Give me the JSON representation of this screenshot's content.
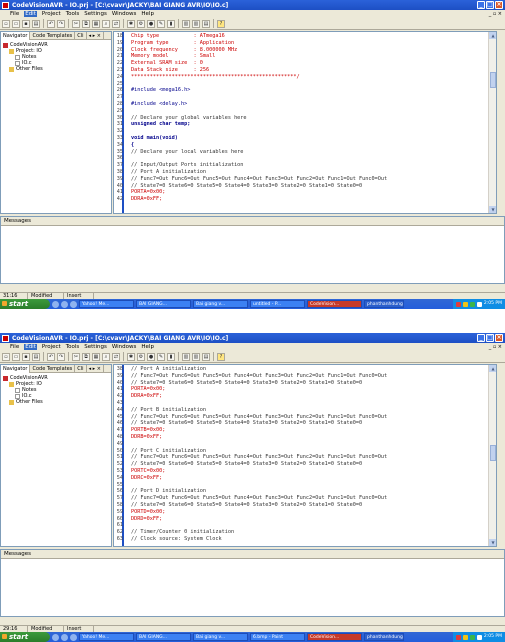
{
  "colors": {
    "titlebar": "#2b62d9",
    "gutter": "#1d4fc4",
    "code_text": "#cc0000",
    "keyword": "#00008b",
    "taskbar": "#245edb"
  },
  "screens": [
    {
      "title": "CodeVisionAVR - IO.prj - [C:\\cvavr\\JACKY\\BAI GIANG AVR\\IO\\IO.c]",
      "menu": [
        "File",
        "Edit",
        "Project",
        "Tools",
        "Settings",
        "Windows",
        "Help"
      ],
      "nav_tabs": [
        "Navigator",
        "Code Templates",
        "Cli"
      ],
      "tree": [
        "CodeVisionAVR",
        "Project: IO",
        "Notes",
        "IO.c",
        "Other Files"
      ],
      "code": [
        {
          "n": "18",
          "t": "Chip type           : ATmega16",
          "k": "str"
        },
        {
          "n": "19",
          "t": "Program type        : Application",
          "k": "str"
        },
        {
          "n": "20",
          "t": "Clock frequency     : 8.000000 MHz",
          "k": "str"
        },
        {
          "n": "21",
          "t": "Memory model        : Small",
          "k": "str"
        },
        {
          "n": "22",
          "t": "External SRAM size  : 0",
          "k": "str"
        },
        {
          "n": "23",
          "t": "Data Stack size     : 256",
          "k": "str"
        },
        {
          "n": "24",
          "t": "*****************************************************/",
          "k": "str"
        },
        {
          "n": "25",
          "t": "",
          "k": "str"
        },
        {
          "n": "26",
          "t": "#include <mega16.h>",
          "k": "inc"
        },
        {
          "n": "27",
          "t": "",
          "k": "str"
        },
        {
          "n": "28",
          "t": "#include <delay.h>",
          "k": "inc"
        },
        {
          "n": "29",
          "t": "",
          "k": "str"
        },
        {
          "n": "30",
          "t": "// Declare your global variables here",
          "k": "cm"
        },
        {
          "n": "31",
          "t": "unsigned char temp;",
          "k": "kw"
        },
        {
          "n": "32",
          "t": "",
          "k": "str"
        },
        {
          "n": "33",
          "t": "void main(void)",
          "k": "kw"
        },
        {
          "n": "34",
          "t": "{",
          "k": "kw"
        },
        {
          "n": "35",
          "t": "// Declare your local variables here",
          "k": "cm"
        },
        {
          "n": "36",
          "t": "",
          "k": "str"
        },
        {
          "n": "37",
          "t": "// Input/Output Ports initialization",
          "k": "cm"
        },
        {
          "n": "38",
          "t": "// Port A initialization",
          "k": "cm"
        },
        {
          "n": "39",
          "t": "// Func7=Out Func6=Out Func5=Out Func4=Out Func3=Out Func2=Out Func1=Out Func0=Out",
          "k": "cm"
        },
        {
          "n": "40",
          "t": "// State7=0 State6=0 State5=0 State4=0 State3=0 State2=0 State1=0 State0=0",
          "k": "cm"
        },
        {
          "n": "41",
          "t": "PORTA=0x00;",
          "k": "str"
        },
        {
          "n": "42",
          "t": "DDRA=0xFF;",
          "k": "str"
        }
      ],
      "messages_title": "Messages",
      "status": {
        "pos": "31:16",
        "modified": "Modified",
        "mode": "Insert"
      },
      "taskbar": {
        "start": "start",
        "items": [
          "Yahoo! Me...",
          "BAI GIANG...",
          "Bai giang v...",
          "untitled - P...",
          "CodeVision...",
          "phanthanhdung"
        ],
        "clock": "2:05 PM"
      }
    },
    {
      "title": "CodeVisionAVR - IO.prj - [C:\\cvavr\\JACKY\\BAI GIANG AVR\\IO\\IO.c]",
      "menu": [
        "File",
        "Edit",
        "Project",
        "Tools",
        "Settings",
        "Windows",
        "Help"
      ],
      "nav_tabs": [
        "Navigator",
        "Code Templates",
        "Cli"
      ],
      "tree": [
        "CodeVisionAVR",
        "Project: IO",
        "Notes",
        "IO.c",
        "Other Files"
      ],
      "code": [
        {
          "n": "38",
          "t": "// Port A initialization",
          "k": "cm"
        },
        {
          "n": "39",
          "t": "// Func7=Out Func6=Out Func5=Out Func4=Out Func3=Out Func2=Out Func1=Out Func0=Out",
          "k": "cm"
        },
        {
          "n": "40",
          "t": "// State7=0 State6=0 State5=0 State4=0 State3=0 State2=0 State1=0 State0=0",
          "k": "cm"
        },
        {
          "n": "41",
          "t": "PORTA=0x00;",
          "k": "str"
        },
        {
          "n": "42",
          "t": "DDRA=0xFF;",
          "k": "str"
        },
        {
          "n": "43",
          "t": "",
          "k": "str"
        },
        {
          "n": "44",
          "t": "// Port B initialization",
          "k": "cm"
        },
        {
          "n": "45",
          "t": "// Func7=Out Func6=Out Func5=Out Func4=Out Func3=Out Func2=Out Func1=Out Func0=Out",
          "k": "cm"
        },
        {
          "n": "46",
          "t": "// State7=0 State6=0 State5=0 State4=0 State3=0 State2=0 State1=0 State0=0",
          "k": "cm"
        },
        {
          "n": "47",
          "t": "PORTB=0x00;",
          "k": "str"
        },
        {
          "n": "48",
          "t": "DDRB=0xFF;",
          "k": "str"
        },
        {
          "n": "49",
          "t": "",
          "k": "str"
        },
        {
          "n": "50",
          "t": "// Port C initialization",
          "k": "cm"
        },
        {
          "n": "51",
          "t": "// Func7=Out Func6=Out Func5=Out Func4=Out Func3=Out Func2=Out Func1=Out Func0=Out",
          "k": "cm"
        },
        {
          "n": "52",
          "t": "// State7=0 State6=0 State5=0 State4=0 State3=0 State2=0 State1=0 State0=0",
          "k": "cm"
        },
        {
          "n": "53",
          "t": "PORTC=0x00;",
          "k": "str"
        },
        {
          "n": "54",
          "t": "DDRC=0xFF;",
          "k": "str"
        },
        {
          "n": "55",
          "t": "",
          "k": "str"
        },
        {
          "n": "56",
          "t": "// Port D initialization",
          "k": "cm"
        },
        {
          "n": "57",
          "t": "// Func7=Out Func6=Out Func5=Out Func4=Out Func3=Out Func2=Out Func1=Out Func0=Out",
          "k": "cm"
        },
        {
          "n": "58",
          "t": "// State7=0 State6=0 State5=0 State4=0 State3=0 State2=0 State1=0 State0=0",
          "k": "cm"
        },
        {
          "n": "59",
          "t": "PORTD=0x00;",
          "k": "str"
        },
        {
          "n": "60",
          "t": "DDRD=0xFF;",
          "k": "str"
        },
        {
          "n": "61",
          "t": "",
          "k": "str"
        },
        {
          "n": "62",
          "t": "// Timer/Counter 0 initialization",
          "k": "cm"
        },
        {
          "n": "63",
          "t": "// Clock source: System Clock",
          "k": "cm"
        }
      ],
      "messages_title": "Messages",
      "status": {
        "pos": "29:16",
        "modified": "Modified",
        "mode": "Insert"
      },
      "taskbar": {
        "start": "start",
        "items": [
          "Yahoo! Me...",
          "BAI GIANG...",
          "Bai giang v...",
          "6.bmp - Paint",
          "CodeVision...",
          "phanthanhdung"
        ],
        "clock": "2:05 PM"
      }
    }
  ]
}
